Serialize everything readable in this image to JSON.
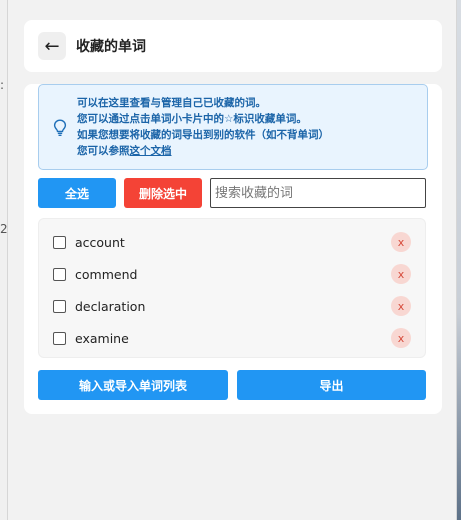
{
  "header": {
    "back_icon": "←",
    "title": "收藏的单词"
  },
  "tip": {
    "icon": "lightbulb-icon",
    "line1": "可以在这里查看与管理自己已收藏的词。",
    "line2": "您可以通过点击单词小卡片中的☆标识收藏单词。",
    "line3": "如果您想要将收藏的词导出到别的软件（如不背单词）",
    "line4_prefix": "您可以参照",
    "line4_link": "这个文档"
  },
  "toolbar": {
    "select_all_label": "全选",
    "delete_selected_label": "删除选中",
    "search_placeholder": "搜索收藏的词"
  },
  "words": [
    {
      "word": "account",
      "remove": "x"
    },
    {
      "word": "commend",
      "remove": "x"
    },
    {
      "word": "declaration",
      "remove": "x"
    },
    {
      "word": "examine",
      "remove": "x"
    }
  ],
  "footer": {
    "import_label": "输入或导入单词列表",
    "export_label": "导出"
  },
  "colors": {
    "primary": "#2196f3",
    "danger": "#f44336",
    "tip_bg": "#e9f4fe",
    "tip_text": "#1b64a8"
  }
}
